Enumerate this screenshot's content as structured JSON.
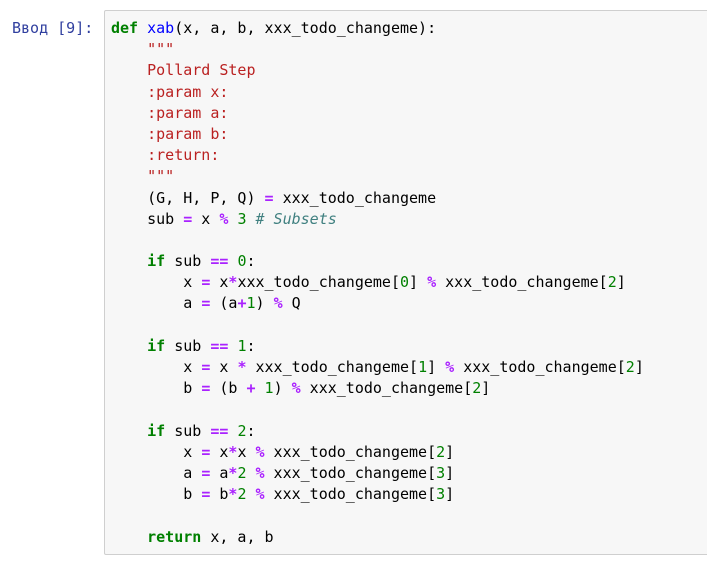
{
  "prompt": "Ввод [9]:",
  "code_lines": [
    [
      [
        "kw",
        "def"
      ],
      [
        "t",
        " "
      ],
      [
        "fn",
        "xab"
      ],
      [
        "t",
        "(x, a, b, xxx_todo_changeme):"
      ]
    ],
    [
      [
        "t",
        "    "
      ],
      [
        "str",
        "\"\"\""
      ]
    ],
    [
      [
        "t",
        "    "
      ],
      [
        "str",
        "Pollard Step"
      ]
    ],
    [
      [
        "t",
        "    "
      ],
      [
        "str",
        ":param x:"
      ]
    ],
    [
      [
        "t",
        "    "
      ],
      [
        "str",
        ":param a:"
      ]
    ],
    [
      [
        "t",
        "    "
      ],
      [
        "str",
        ":param b:"
      ]
    ],
    [
      [
        "t",
        "    "
      ],
      [
        "str",
        ":return:"
      ]
    ],
    [
      [
        "t",
        "    "
      ],
      [
        "str",
        "\"\"\""
      ]
    ],
    [
      [
        "t",
        "    (G, H, P, Q) "
      ],
      [
        "op",
        "="
      ],
      [
        "t",
        " xxx_todo_changeme"
      ]
    ],
    [
      [
        "t",
        "    sub "
      ],
      [
        "op",
        "="
      ],
      [
        "t",
        " x "
      ],
      [
        "op",
        "%"
      ],
      [
        "t",
        " "
      ],
      [
        "num",
        "3"
      ],
      [
        "t",
        " "
      ],
      [
        "cm",
        "# Subsets"
      ]
    ],
    [],
    [
      [
        "t",
        "    "
      ],
      [
        "kw",
        "if"
      ],
      [
        "t",
        " sub "
      ],
      [
        "op",
        "=="
      ],
      [
        "t",
        " "
      ],
      [
        "num",
        "0"
      ],
      [
        "t",
        ":"
      ]
    ],
    [
      [
        "t",
        "        x "
      ],
      [
        "op",
        "="
      ],
      [
        "t",
        " x"
      ],
      [
        "op",
        "*"
      ],
      [
        "t",
        "xxx_todo_changeme["
      ],
      [
        "num",
        "0"
      ],
      [
        "t",
        "] "
      ],
      [
        "op",
        "%"
      ],
      [
        "t",
        " xxx_todo_changeme["
      ],
      [
        "num",
        "2"
      ],
      [
        "t",
        "]"
      ]
    ],
    [
      [
        "t",
        "        a "
      ],
      [
        "op",
        "="
      ],
      [
        "t",
        " (a"
      ],
      [
        "op",
        "+"
      ],
      [
        "num",
        "1"
      ],
      [
        "t",
        ") "
      ],
      [
        "op",
        "%"
      ],
      [
        "t",
        " Q"
      ]
    ],
    [],
    [
      [
        "t",
        "    "
      ],
      [
        "kw",
        "if"
      ],
      [
        "t",
        " sub "
      ],
      [
        "op",
        "=="
      ],
      [
        "t",
        " "
      ],
      [
        "num",
        "1"
      ],
      [
        "t",
        ":"
      ]
    ],
    [
      [
        "t",
        "        x "
      ],
      [
        "op",
        "="
      ],
      [
        "t",
        " x "
      ],
      [
        "op",
        "*"
      ],
      [
        "t",
        " xxx_todo_changeme["
      ],
      [
        "num",
        "1"
      ],
      [
        "t",
        "] "
      ],
      [
        "op",
        "%"
      ],
      [
        "t",
        " xxx_todo_changeme["
      ],
      [
        "num",
        "2"
      ],
      [
        "t",
        "]"
      ]
    ],
    [
      [
        "t",
        "        b "
      ],
      [
        "op",
        "="
      ],
      [
        "t",
        " (b "
      ],
      [
        "op",
        "+"
      ],
      [
        "t",
        " "
      ],
      [
        "num",
        "1"
      ],
      [
        "t",
        ") "
      ],
      [
        "op",
        "%"
      ],
      [
        "t",
        " xxx_todo_changeme["
      ],
      [
        "num",
        "2"
      ],
      [
        "t",
        "]"
      ]
    ],
    [],
    [
      [
        "t",
        "    "
      ],
      [
        "kw",
        "if"
      ],
      [
        "t",
        " sub "
      ],
      [
        "op",
        "=="
      ],
      [
        "t",
        " "
      ],
      [
        "num",
        "2"
      ],
      [
        "t",
        ":"
      ]
    ],
    [
      [
        "t",
        "        x "
      ],
      [
        "op",
        "="
      ],
      [
        "t",
        " x"
      ],
      [
        "op",
        "*"
      ],
      [
        "t",
        "x "
      ],
      [
        "op",
        "%"
      ],
      [
        "t",
        " xxx_todo_changeme["
      ],
      [
        "num",
        "2"
      ],
      [
        "t",
        "]"
      ]
    ],
    [
      [
        "t",
        "        a "
      ],
      [
        "op",
        "="
      ],
      [
        "t",
        " a"
      ],
      [
        "op",
        "*"
      ],
      [
        "num",
        "2"
      ],
      [
        "t",
        " "
      ],
      [
        "op",
        "%"
      ],
      [
        "t",
        " xxx_todo_changeme["
      ],
      [
        "num",
        "3"
      ],
      [
        "t",
        "]"
      ]
    ],
    [
      [
        "t",
        "        b "
      ],
      [
        "op",
        "="
      ],
      [
        "t",
        " b"
      ],
      [
        "op",
        "*"
      ],
      [
        "num",
        "2"
      ],
      [
        "t",
        " "
      ],
      [
        "op",
        "%"
      ],
      [
        "t",
        " xxx_todo_changeme["
      ],
      [
        "num",
        "3"
      ],
      [
        "t",
        "]"
      ]
    ],
    [],
    [
      [
        "t",
        "    "
      ],
      [
        "kw",
        "return"
      ],
      [
        "t",
        " x, a, b"
      ]
    ]
  ]
}
